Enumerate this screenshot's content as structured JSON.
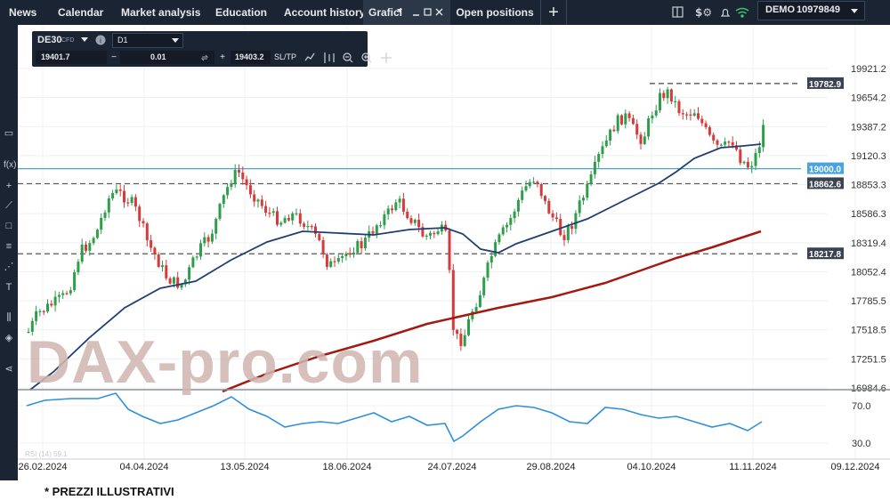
{
  "top_nav": {
    "items": [
      "News",
      "Calendar",
      "Market analysis",
      "Education",
      "Account history"
    ],
    "active_tab": "Grafici",
    "open_positions": "Open positions",
    "add_label": "+",
    "account_label": "DEMO",
    "account_number": "10979849"
  },
  "toolbar": {
    "symbol": "DE30",
    "symbol_type": "CFD",
    "timeframe": "D1",
    "bid": "19401.7",
    "minus": "−",
    "volume": "0.01",
    "plus": "+",
    "ask": "19403.2",
    "sltp": "SL/TP"
  },
  "icons": {
    "tab_menu": "chevron-down-icon",
    "tab_minimize": "minimize-icon",
    "tab_maximize": "maximize-icon",
    "tab_close": "close-icon",
    "layout": "layout-icon",
    "dollar": "dollar-settings-icon",
    "bell": "bell-icon",
    "wifi": "wifi-icon"
  },
  "price_axis": {
    "ticks": [
      "19921.2",
      "19654.2",
      "19387.2",
      "19120.3",
      "18853.3",
      "18586.3",
      "18319.4",
      "18052.4",
      "17785.5",
      "17518.5",
      "17251.5",
      "16984.6"
    ],
    "level_labels": [
      "19782.9",
      "19000.0",
      "18862.6",
      "18217.8"
    ],
    "rsi_ticks": [
      "70.0",
      "30.0"
    ]
  },
  "x_axis": {
    "dates": [
      "26.02.2024",
      "04.04.2024",
      "13.05.2024",
      "18.06.2024",
      "24.07.2024",
      "29.08.2024",
      "04.10.2024",
      "11.11.2024",
      "09.12.2024"
    ]
  },
  "rsi_label": "RSI (14) 59.1",
  "watermark": "DAX-pro.com",
  "footer_note": "* PREZZI ILLUSTRATIVI",
  "colors": {
    "bull": "#2e9e4a",
    "bear": "#d63b3b",
    "ma_fast": "#1f3f73",
    "ma_slow": "#a31a12",
    "level_blue": "#4aa3e0",
    "rsi": "#2f8fdc",
    "nav_bg": "#1b2433"
  }
}
